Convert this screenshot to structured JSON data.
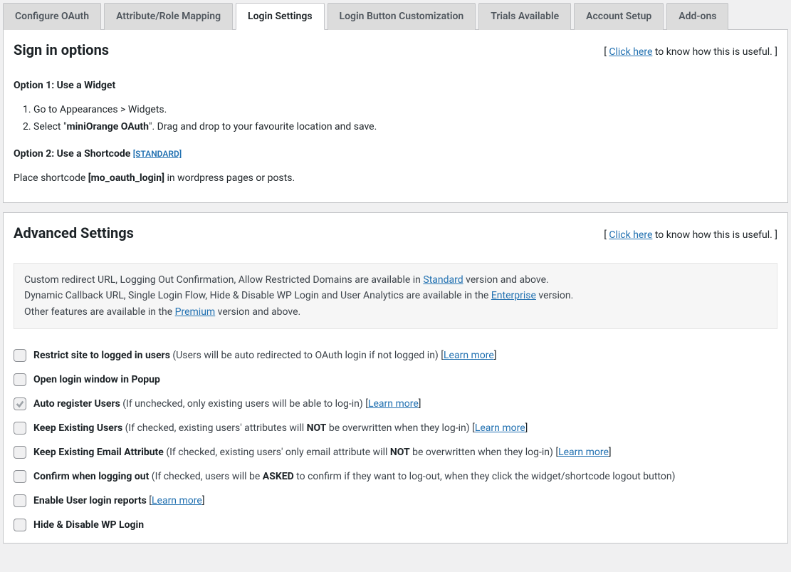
{
  "tabs": [
    {
      "label": "Configure OAuth",
      "active": false
    },
    {
      "label": "Attribute/Role Mapping",
      "active": false
    },
    {
      "label": "Login Settings",
      "active": true
    },
    {
      "label": "Login Button Customization",
      "active": false
    },
    {
      "label": "Trials Available",
      "active": false
    },
    {
      "label": "Account Setup",
      "active": false
    },
    {
      "label": "Add-ons",
      "active": false
    }
  ],
  "signin": {
    "title": "Sign in options",
    "useful_prefix": "[ ",
    "useful_link": "Click here",
    "useful_suffix": " to know how this is useful. ]",
    "option1_heading": "Option 1: Use a Widget",
    "step1": "Go to Appearances > Widgets.",
    "step2_a": "Select \"",
    "step2_b": "miniOrange OAuth",
    "step2_c": "\". Drag and drop to your favourite location and save.",
    "option2_heading": "Option 2: Use a Shortcode ",
    "option2_badge": "[STANDARD]",
    "shortcode_a": "Place shortcode ",
    "shortcode_b": "[mo_oauth_login]",
    "shortcode_c": " in wordpress pages or posts."
  },
  "advanced": {
    "title": "Advanced Settings",
    "useful_prefix": "[ ",
    "useful_link": "Click here",
    "useful_suffix": " to know how this is useful. ]",
    "info_l1a": "Custom redirect URL, Logging Out Confirmation, Allow Restricted Domains are available in ",
    "info_l1b": "Standard",
    "info_l1c": " version and above.",
    "info_l2a": "Dynamic Callback URL, Single Login Flow, Hide & Disable WP Login and User Analytics are available in the ",
    "info_l2b": "Enterprise",
    "info_l2c": " version.",
    "info_l3a": "Other features are available in the ",
    "info_l3b": "Premium",
    "info_l3c": " version and above.",
    "learn_more": "Learn more",
    "rows": {
      "restrict": {
        "bold": "Restrict site to logged in users",
        "hint": " (Users will be auto redirected to OAuth login if not logged in) [",
        "has_learn": true,
        "close": "]"
      },
      "popup": {
        "bold": "Open login window in Popup",
        "hint": "",
        "has_learn": false,
        "close": ""
      },
      "autoreg": {
        "bold": "Auto register Users",
        "hint": " (If unchecked, only existing users will be able to log-in) [",
        "has_learn": true,
        "close": "]"
      },
      "keepusers": {
        "bold": "Keep Existing Users",
        "hint_a": " (If checked, existing users' attributes will ",
        "not": "NOT",
        "hint_b": " be overwritten when they log-in) [",
        "has_learn": true,
        "close": "]"
      },
      "keepemail": {
        "bold": "Keep Existing Email Attribute",
        "hint_a": " (If checked, existing users' only email attribute will ",
        "not": "NOT",
        "hint_b": " be overwritten when they log-in) [",
        "has_learn": true,
        "close": "]"
      },
      "confirm": {
        "bold": "Confirm when logging out",
        "hint_a": " (If checked, users will be ",
        "asked": "ASKED",
        "hint_b": " to confirm if they want to log-out, when they click the widget/shortcode logout button)",
        "has_learn": false,
        "close": ""
      },
      "reports": {
        "bold": "Enable User login reports",
        "hint": " [",
        "has_learn": true,
        "close": "]"
      },
      "hidewp": {
        "bold": "Hide & Disable WP Login",
        "hint": "",
        "has_learn": false,
        "close": ""
      }
    }
  }
}
